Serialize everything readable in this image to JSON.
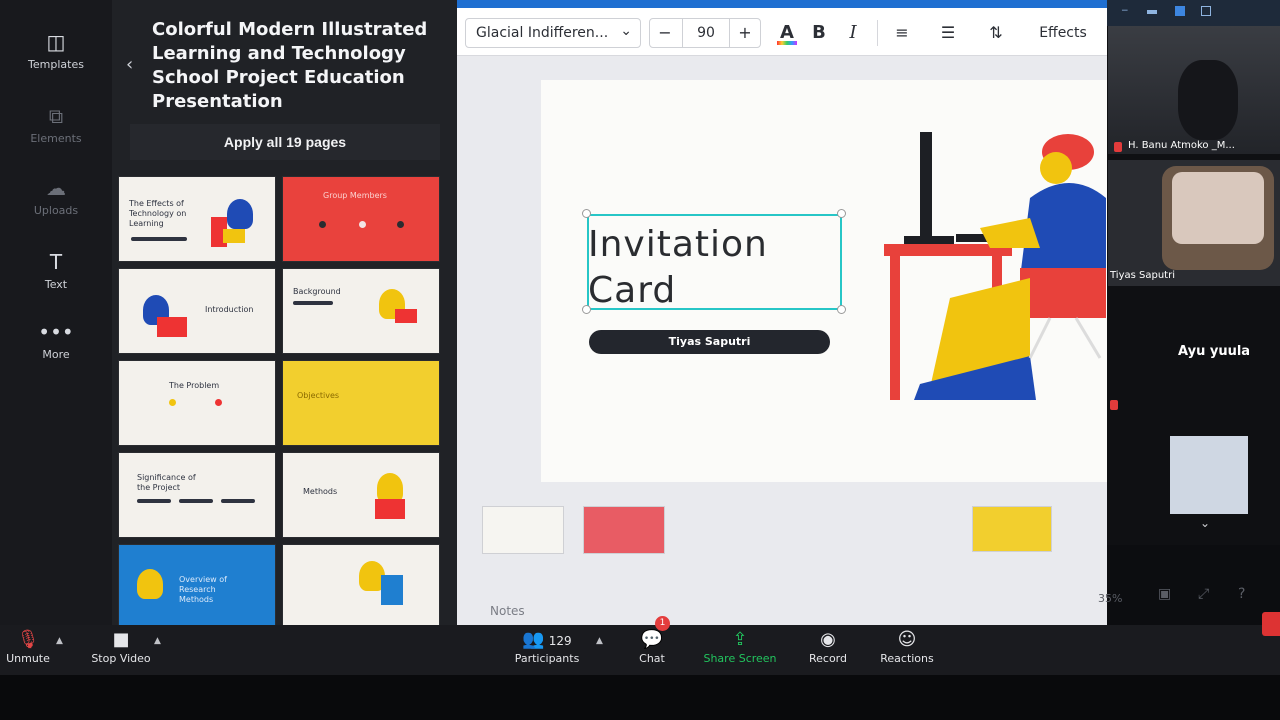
{
  "rail": {
    "items": [
      {
        "label": "Templates",
        "icon": "templates-icon"
      },
      {
        "label": "Elements",
        "icon": "elements-icon"
      },
      {
        "label": "Uploads",
        "icon": "uploads-icon"
      },
      {
        "label": "Text",
        "icon": "text-icon"
      },
      {
        "label": "More",
        "icon": "more-icon"
      }
    ]
  },
  "panel": {
    "title": "Colorful Modern Illustrated Learning and Technology School Project Education Presentation",
    "apply_label": "Apply all 19 pages",
    "thumbs": [
      {
        "text": "The Effects of Technology on Learning"
      },
      {
        "text": "Group Members"
      },
      {
        "text": "Introduction"
      },
      {
        "text": "Background"
      },
      {
        "text": "The Problem"
      },
      {
        "text": "Objectives"
      },
      {
        "text": "Significance of the Project"
      },
      {
        "text": "Methods"
      },
      {
        "text": "Overview of Research Methods"
      },
      {
        "text": ""
      }
    ]
  },
  "toolbar": {
    "font_name": "Glacial Indifferen...",
    "minus": "−",
    "font_size": "90",
    "plus": "+",
    "color_label": "A",
    "bold_label": "B",
    "italic_label": "I",
    "effects_label": "Effects"
  },
  "canvas": {
    "title_line1": "Invitation",
    "title_line2": "Card",
    "name_pill": "Tiyas Saputri"
  },
  "editor": {
    "notes_label": "Notes",
    "zoom_level": "35%"
  },
  "video": {
    "participants": [
      {
        "name": "H. Banu Atmoko _M..."
      },
      {
        "name": "Tiyas Saputri"
      },
      {
        "name": "Ayu yuula"
      }
    ]
  },
  "zoombar": {
    "unmute_label": "Unmute",
    "stop_video_label": "Stop Video",
    "participants_label": "Participants",
    "participants_count": "129",
    "chat_label": "Chat",
    "chat_badge": "1",
    "share_label": "Share Screen",
    "record_label": "Record",
    "reactions_label": "Reactions"
  },
  "colors": {
    "canva_dark": "#18191d",
    "selection": "#27c6c7",
    "share_green": "#22c55e",
    "accent_red": "#e9423d",
    "accent_yellow": "#f2cf2e",
    "accent_blue": "#1f7fd0"
  }
}
